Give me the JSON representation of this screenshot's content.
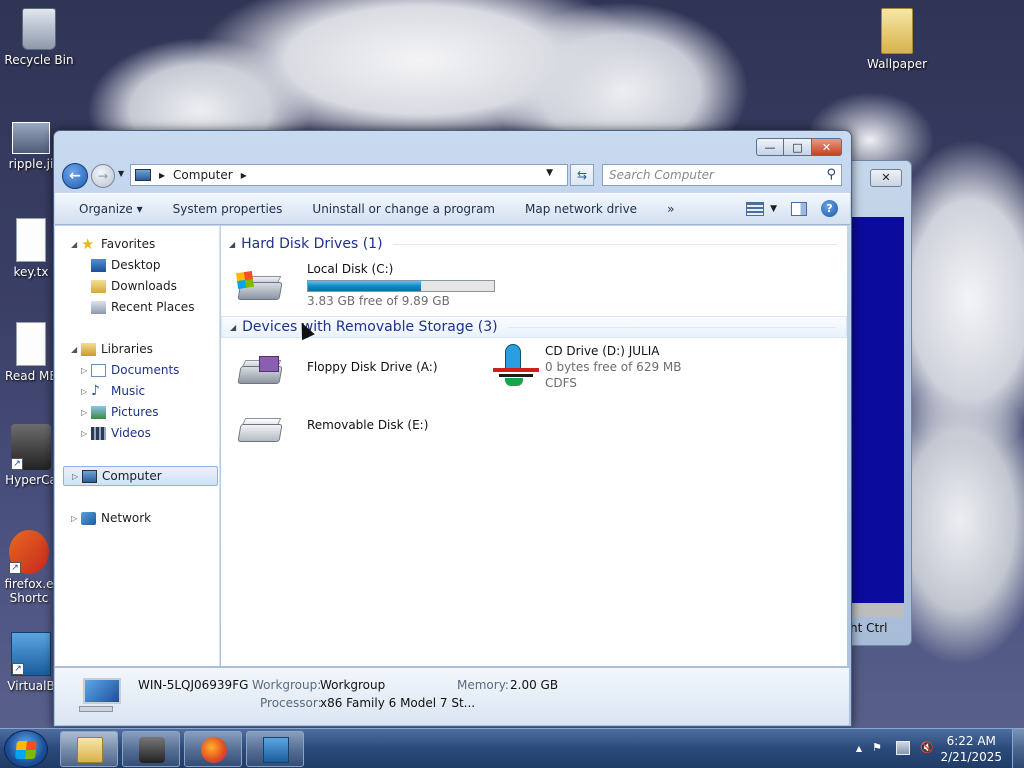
{
  "desktop": {
    "icons": [
      {
        "label": "Recycle Bin",
        "icon": "recycle-bin-icon"
      },
      {
        "label": "ripple.ji",
        "icon": "image-file-icon"
      },
      {
        "label": "key.tx",
        "icon": "text-file-icon"
      },
      {
        "label": "Read ME",
        "icon": "text-file-icon"
      },
      {
        "label": "HyperCa",
        "icon": "hypercam-icon"
      },
      {
        "label": "firefox.e",
        "label2": "Shortc",
        "icon": "firefox-icon"
      },
      {
        "label": "VirtualB",
        "icon": "virtualbox-icon"
      },
      {
        "label": "Wallpaper",
        "icon": "folder-icon"
      }
    ]
  },
  "background_window": {
    "status_text": "ht Ctrl",
    "close_label": "✕"
  },
  "window": {
    "caption": {
      "minimize": "—",
      "maximize": "□",
      "close": "✕"
    },
    "address": {
      "crumb": "Computer",
      "sep": "▸"
    },
    "search": {
      "placeholder": "Search Computer"
    },
    "toolbar": {
      "organize": "Organize ▾",
      "system_properties": "System properties",
      "uninstall": "Uninstall or change a program",
      "map_drive": "Map network drive",
      "more": "»"
    },
    "nav": {
      "favorites": "Favorites",
      "desktop": "Desktop",
      "downloads": "Downloads",
      "recent": "Recent Places",
      "libraries": "Libraries",
      "documents": "Documents",
      "music": "Music",
      "pictures": "Pictures",
      "videos": "Videos",
      "computer": "Computer",
      "network": "Network"
    },
    "groups": {
      "hdd": "Hard Disk Drives (1)",
      "removable": "Devices with Removable Storage (3)"
    },
    "drives": {
      "c": {
        "name": "Local Disk (C:)",
        "free": "3.83 GB free of 9.89 GB",
        "used_fraction": 0.61
      },
      "a": {
        "name": "Floppy Disk Drive (A:)"
      },
      "d": {
        "name": "CD Drive (D:) JULIA",
        "free": "0 bytes free of 629 MB",
        "fs": "CDFS"
      },
      "e": {
        "name": "Removable Disk (E:)"
      }
    },
    "details": {
      "computer_name": "WIN-5LQJ06939FG",
      "workgroup_label": "Workgroup:",
      "workgroup": "Workgroup",
      "memory_label": "Memory:",
      "memory": "2.00 GB",
      "processor_label": "Processor:",
      "processor": "x86 Family 6 Model 7 St..."
    }
  },
  "taskbar": {
    "clock_time": "6:22 AM",
    "clock_date": "2/21/2025",
    "pinned": [
      "explorer-icon",
      "hypercam-icon",
      "firefox-icon",
      "activity-monitor-icon"
    ],
    "tray_arrow": "▲"
  },
  "colors": {
    "accent": "#1e3287",
    "progress": "#1888c2",
    "taskbar": "#2b4a7a"
  }
}
